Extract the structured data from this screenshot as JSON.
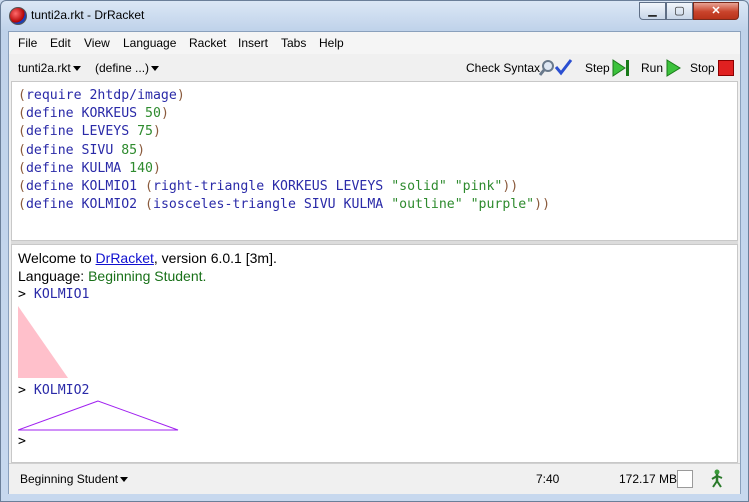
{
  "window": {
    "title": "tunti2a.rkt - DrRacket"
  },
  "menu": [
    "File",
    "Edit",
    "View",
    "Language",
    "Racket",
    "Insert",
    "Tabs",
    "Help"
  ],
  "toolbar": {
    "file_menu": "tunti2a.rkt",
    "define_menu": "(define ...)",
    "check_syntax": "Check Syntax",
    "step": "Step",
    "run": "Run",
    "stop": "Stop"
  },
  "editor": {
    "lines": [
      {
        "open": "(",
        "kw": "require 2htdp/image",
        "close": ")"
      },
      {
        "open": "(",
        "kw": "define KORKEUS ",
        "num": "50",
        "close": ")"
      },
      {
        "open": "(",
        "kw": "define LEVEYS ",
        "num": "75",
        "close": ")"
      },
      {
        "open": "(",
        "kw": "define SIVU ",
        "num": "85",
        "close": ")"
      },
      {
        "open": "(",
        "kw": "define KULMA ",
        "num": "140",
        "close": ")"
      },
      {
        "open": "(",
        "kw": "define KOLMIO1 ",
        "inner_open": "(",
        "inner": "right-triangle KORKEUS LEVEYS ",
        "str1": "\"solid\"",
        "sp": " ",
        "str2": "\"pink\"",
        "close": "))"
      },
      {
        "open": "(",
        "kw": "define KOLMIO2 ",
        "inner_open": "(",
        "inner": "isosceles-triangle SIVU KULMA ",
        "str1": "\"outline\"",
        "sp": " ",
        "str2": "\"purple\"",
        "close": "))"
      }
    ]
  },
  "repl": {
    "welcome_prefix": "Welcome to ",
    "welcome_link": "DrRacket",
    "welcome_suffix": ", version 6.0.1 [3m].",
    "language_prefix": "Language: ",
    "language_name": "Beginning Student",
    "language_suffix": ".",
    "prompt": ">",
    "cmd1": "KOLMIO1",
    "cmd2": "KOLMIO2",
    "triangle1_color": "#ffc0cb",
    "triangle2_color": "#a020f0"
  },
  "status": {
    "language": "Beginning Student",
    "position": "7:40",
    "memory": "172.17 MB"
  },
  "icons": [
    "racket-logo-icon",
    "minimize-icon",
    "maximize-icon",
    "close-icon",
    "check-syntax-icon",
    "step-icon",
    "run-icon",
    "stop-icon",
    "walker-icon"
  ]
}
